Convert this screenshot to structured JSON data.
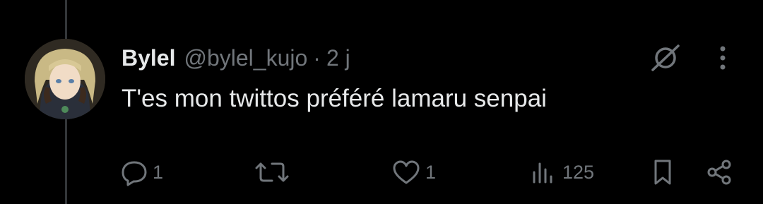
{
  "tweet": {
    "author": {
      "display_name": "Bylel",
      "handle": "@bylel_kujo"
    },
    "separator": "·",
    "time": "2 j",
    "text": "T'es mon twittos préféré lamaru senpai"
  },
  "actions": {
    "reply_count": "1",
    "like_count": "1",
    "views_count": "125"
  },
  "icons": {
    "reply": "reply-icon",
    "retweet": "retweet-icon",
    "like": "heart-icon",
    "views": "views-chart-icon",
    "bookmark": "bookmark-icon",
    "share": "share-icon",
    "grok": "grok-icon",
    "more": "more-icon"
  },
  "colors": {
    "background": "#000000",
    "primary_text": "#e7e9ea",
    "secondary_text": "#71767b",
    "thread_line": "#333639"
  }
}
